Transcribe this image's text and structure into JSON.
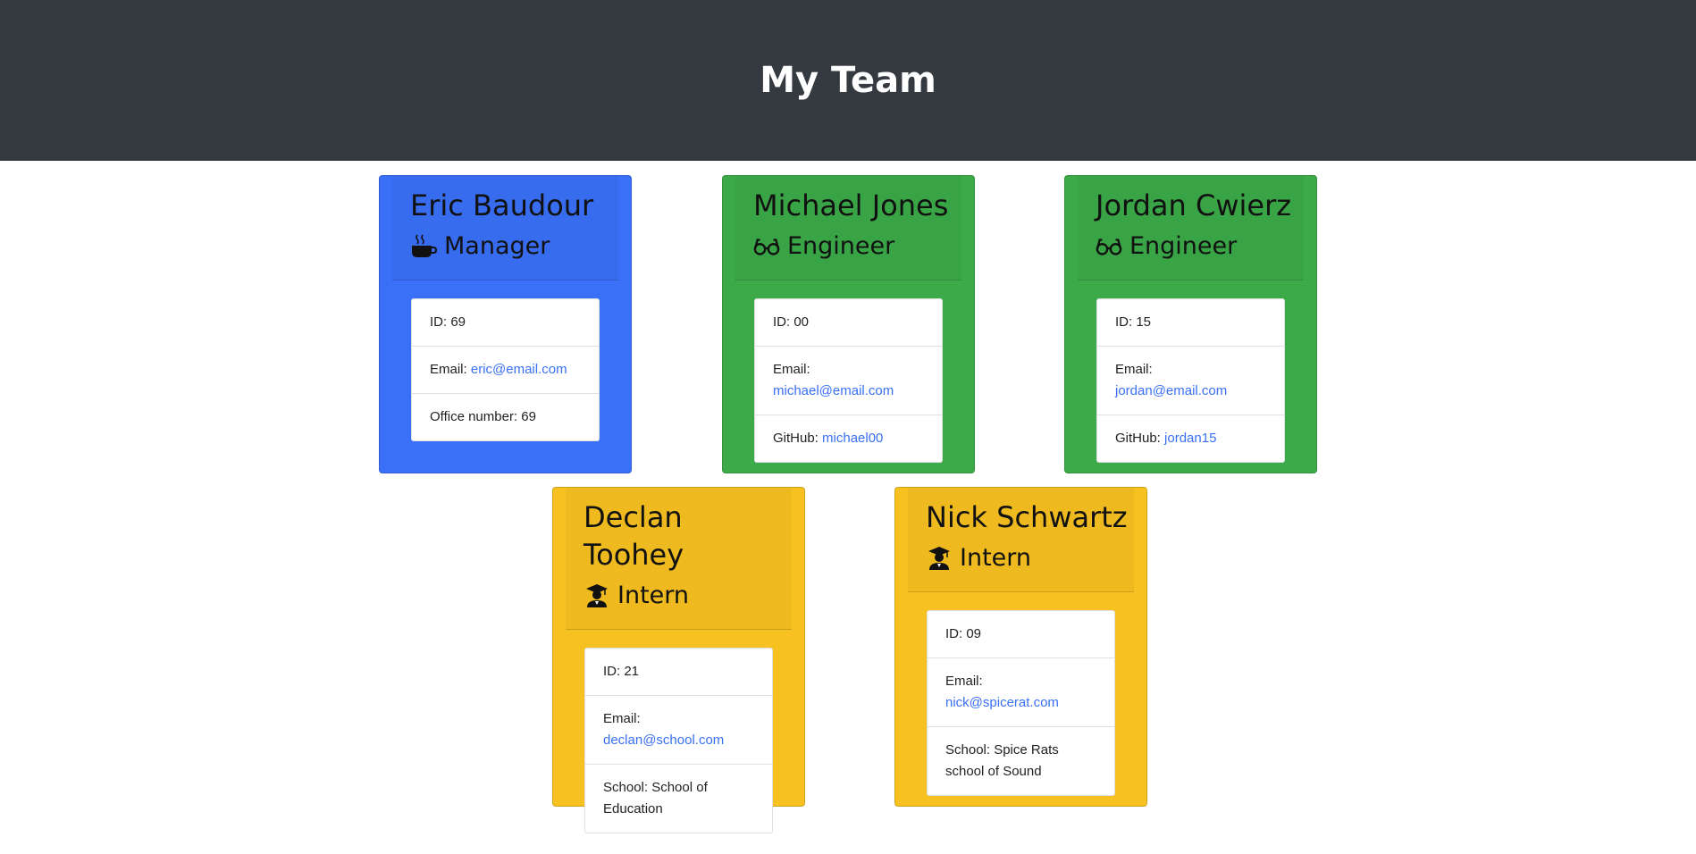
{
  "header": {
    "title": "My Team"
  },
  "employees": [
    {
      "name": "Eric Baudour",
      "role": "Manager",
      "icon": "coffee-icon",
      "id_label": "ID: 69",
      "email_label": "Email:",
      "email": "eric@email.com",
      "extra_label": "Office number: 69",
      "color": "#3a70f7"
    },
    {
      "name": "Michael Jones",
      "role": "Engineer",
      "icon": "glasses-icon",
      "id_label": "ID: 00",
      "email_label": "Email:",
      "email": "michael@email.com",
      "extra_label": "GitHub:",
      "extra_link": "michael00",
      "color": "#3caa48"
    },
    {
      "name": "Jordan Cwierz",
      "role": "Engineer",
      "icon": "glasses-icon",
      "id_label": "ID: 15",
      "email_label": "Email:",
      "email": "jordan@email.com",
      "extra_label": "GitHub:",
      "extra_link": "jordan15",
      "color": "#3caa48"
    },
    {
      "name": "Declan Toohey",
      "role": "Intern",
      "icon": "graduate-icon",
      "id_label": "ID: 21",
      "email_label": "Email:",
      "email": "declan@school.com",
      "extra_label": "School: School of Education",
      "color": "#f7c121"
    },
    {
      "name": "Nick Schwartz",
      "role": "Intern",
      "icon": "graduate-icon",
      "id_label": "ID: 09",
      "email_label": "Email:",
      "email": "nick@spicerat.com",
      "extra_label": "School: Spice Rats school of Sound",
      "color": "#f7c121"
    }
  ]
}
